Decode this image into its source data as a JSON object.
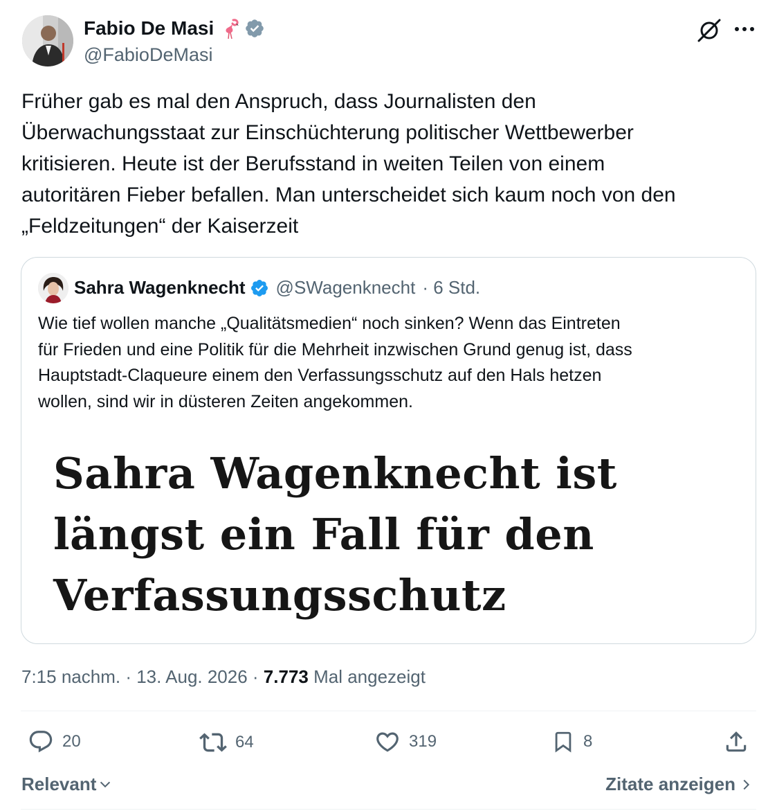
{
  "author": {
    "name": "Fabio De Masi",
    "handle": "@FabioDeMasi",
    "emoji": "flamingo-emoji",
    "verified": true
  },
  "tweet": {
    "lines": [
      "Früher gab es mal den Anspruch, dass Journalisten den",
      "Überwachungsstaat zur Einschüchterung politischer Wettbewerber",
      "kritisieren. Heute ist der Berufsstand in weiten Teilen von einem",
      "autoritären Fieber befallen. Man unterscheidet sich kaum noch von den",
      "„Feldzeitungen“ der Kaiserzeit"
    ]
  },
  "quote": {
    "name": "Sahra Wagenknecht",
    "handle": "@SWagenknecht",
    "time": "· 6 Std.",
    "lines": [
      "Wie tief wollen manche „Qualitätsmedien“ noch sinken? Wenn das Eintreten",
      "für Frieden und eine Politik für die Mehrheit inzwischen Grund genug ist, dass",
      "Hauptstadt-Claqueure einem den Verfassungsschutz auf den Hals hetzen",
      "wollen, sind wir in düsteren Zeiten angekommen."
    ],
    "image_lines": [
      "Sahra Wagenknecht ist",
      "längst ein Fall für den",
      "Verfassungsschutz"
    ]
  },
  "meta": {
    "time": "7:15 nachm.",
    "sep1": " · ",
    "date": "13. Aug. 2026",
    "sep2": " · ",
    "views": "7.773",
    "views_label": " Mal angezeigt"
  },
  "actions": {
    "reply_count": "20",
    "retweet_count": "64",
    "like_count": "319",
    "bookmark_count": "8"
  },
  "footer": {
    "sort_label": "Relevant",
    "quotes_label": "Zitate anzeigen"
  },
  "colors": {
    "verified": "#1d9bf0",
    "text": "#0f1419",
    "secondary": "#536471",
    "border": "#cfd9de"
  }
}
